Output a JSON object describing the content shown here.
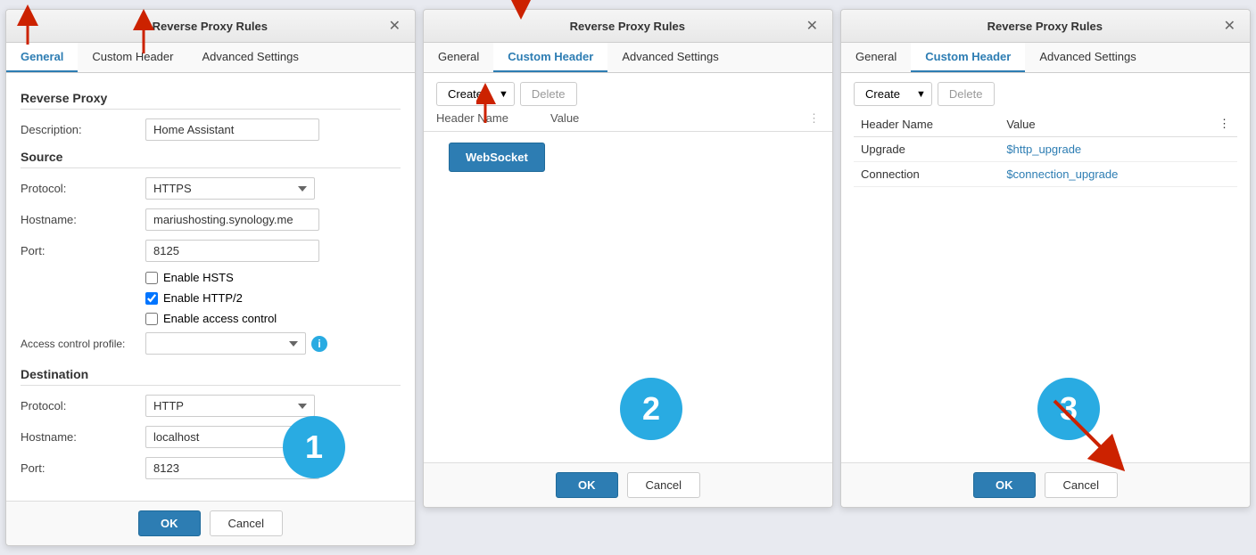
{
  "panel1": {
    "title": "Reverse Proxy Rules",
    "tabs": [
      {
        "label": "General",
        "active": true
      },
      {
        "label": "Custom Header",
        "active": false
      },
      {
        "label": "Advanced Settings",
        "active": false
      }
    ],
    "sections": {
      "reverseProxy": "Reverse Proxy",
      "description_label": "Description:",
      "description_value": "Home Assistant",
      "source": "Source",
      "protocol_label": "Protocol:",
      "protocol_value": "HTTPS",
      "hostname_label": "Hostname:",
      "hostname_value": "mariushosting.synology.me",
      "port_label": "Port:",
      "port_value": "8125",
      "enable_hsts": "Enable HSTS",
      "enable_http2": "Enable HTTP/2",
      "enable_access_control": "Enable access control",
      "access_control_profile_label": "Access control profile:",
      "destination": "Destination",
      "dest_protocol_label": "Protocol:",
      "dest_protocol_value": "HTTP",
      "dest_hostname_label": "Hostname:",
      "dest_hostname_value": "localhost",
      "dest_port_label": "Port:",
      "dest_port_value": "8123"
    },
    "footer": {
      "ok": "OK",
      "cancel": "Cancel"
    },
    "circle": "1"
  },
  "panel2": {
    "title": "Reverse Proxy Rules",
    "tabs": [
      {
        "label": "General",
        "active": false
      },
      {
        "label": "Custom Header",
        "active": true
      },
      {
        "label": "Advanced Settings",
        "active": false
      }
    ],
    "toolbar": {
      "create": "Create",
      "delete": "Delete",
      "header_name": "Header Name",
      "value": "Value"
    },
    "websocket_btn": "WebSocket",
    "footer": {
      "ok": "OK",
      "cancel": "Cancel"
    },
    "circle": "2"
  },
  "panel3": {
    "title": "Reverse Proxy Rules",
    "tabs": [
      {
        "label": "General",
        "active": false
      },
      {
        "label": "Custom Header",
        "active": true
      },
      {
        "label": "Advanced Settings",
        "active": false
      }
    ],
    "toolbar": {
      "create": "Create",
      "delete": "Delete"
    },
    "table": {
      "col_header_name": "Header Name",
      "col_value": "Value",
      "rows": [
        {
          "name": "Upgrade",
          "value": "$http_upgrade"
        },
        {
          "name": "Connection",
          "value": "$connection_upgrade"
        }
      ]
    },
    "footer": {
      "ok": "OK",
      "cancel": "Cancel"
    },
    "circle": "3"
  },
  "arrow1_tab1": "↑",
  "arrow1_tab2": "↑",
  "top_banner": "Reverse Proxy Rules"
}
